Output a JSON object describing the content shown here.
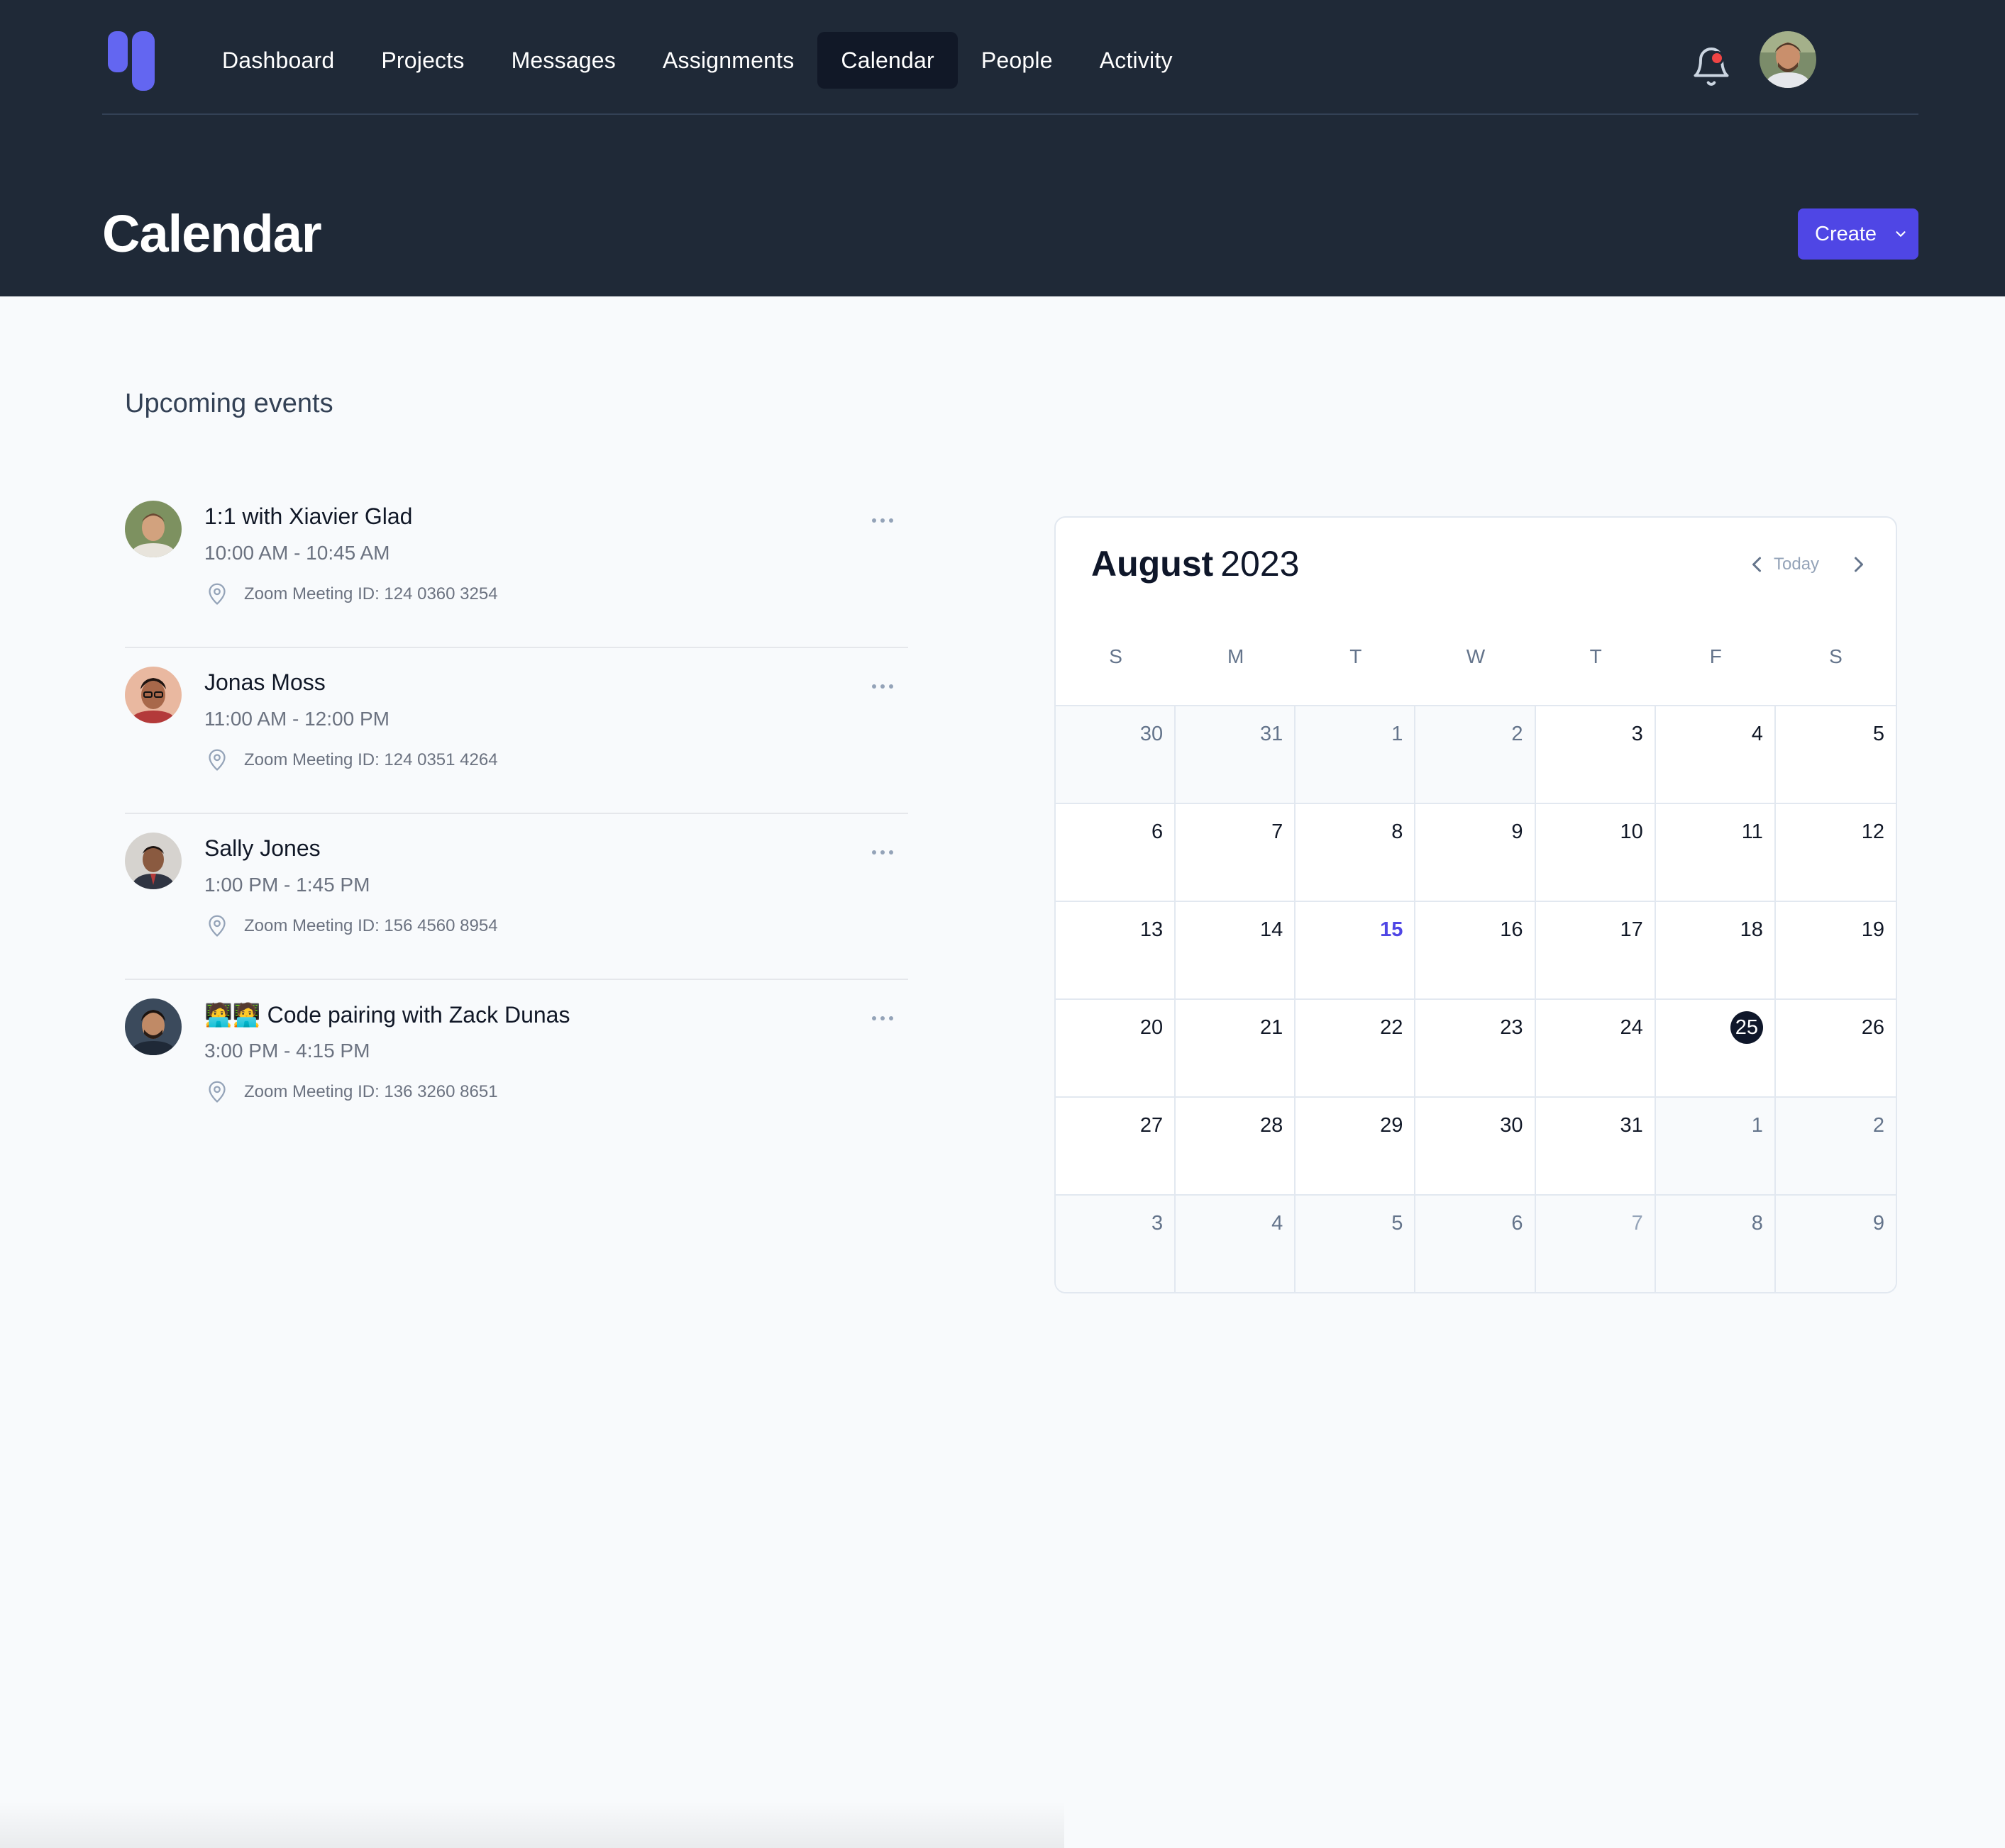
{
  "nav": {
    "items": [
      {
        "label": "Dashboard",
        "active": false
      },
      {
        "label": "Projects",
        "active": false
      },
      {
        "label": "Messages",
        "active": false
      },
      {
        "label": "Assignments",
        "active": false
      },
      {
        "label": "Calendar",
        "active": true
      },
      {
        "label": "People",
        "active": false
      },
      {
        "label": "Activity",
        "active": false
      }
    ],
    "notification_icon": "bell-icon",
    "has_notification": true
  },
  "page": {
    "title": "Calendar",
    "create_label": "Create"
  },
  "events": {
    "heading": "Upcoming events",
    "items": [
      {
        "title": "1:1 with Xiavier Glad",
        "time": "10:00 AM - 10:45 AM",
        "location": "Zoom Meeting ID: 124 0360 3254"
      },
      {
        "title": "Jonas Moss",
        "time": "11:00 AM - 12:00 PM",
        "location": "Zoom Meeting ID: 124 0351 4264"
      },
      {
        "title": "Sally Jones",
        "time": "1:00 PM - 1:45 PM",
        "location": "Zoom Meeting ID: 156 4560 8954"
      },
      {
        "title": "🧑‍💻🧑‍💻 Code pairing with Zack Dunas",
        "time": "3:00 PM - 4:15 PM",
        "location": "Zoom Meeting ID: 136 3260 8651"
      }
    ]
  },
  "calendar": {
    "month": "August",
    "year": "2023",
    "today_label": "Today",
    "weekdays": [
      "S",
      "M",
      "T",
      "W",
      "T",
      "F",
      "S"
    ],
    "days": [
      {
        "n": "30",
        "out": true
      },
      {
        "n": "31",
        "out": true
      },
      {
        "n": "1",
        "out": true
      },
      {
        "n": "2",
        "out": true
      },
      {
        "n": "3"
      },
      {
        "n": "4"
      },
      {
        "n": "5"
      },
      {
        "n": "6"
      },
      {
        "n": "7"
      },
      {
        "n": "8"
      },
      {
        "n": "9"
      },
      {
        "n": "10"
      },
      {
        "n": "11"
      },
      {
        "n": "12"
      },
      {
        "n": "13"
      },
      {
        "n": "14"
      },
      {
        "n": "15",
        "today": true
      },
      {
        "n": "16"
      },
      {
        "n": "17"
      },
      {
        "n": "18"
      },
      {
        "n": "19"
      },
      {
        "n": "20"
      },
      {
        "n": "21"
      },
      {
        "n": "22"
      },
      {
        "n": "23"
      },
      {
        "n": "24"
      },
      {
        "n": "25",
        "selected": true
      },
      {
        "n": "26"
      },
      {
        "n": "27"
      },
      {
        "n": "28"
      },
      {
        "n": "29"
      },
      {
        "n": "30"
      },
      {
        "n": "31"
      },
      {
        "n": "1",
        "out": true
      },
      {
        "n": "2",
        "out": true
      },
      {
        "n": "3",
        "out": true
      },
      {
        "n": "4",
        "out": true
      },
      {
        "n": "5",
        "out": true
      },
      {
        "n": "6",
        "out": true
      },
      {
        "n": "7",
        "out": true,
        "faint": true
      },
      {
        "n": "8",
        "out": true
      },
      {
        "n": "9",
        "out": true
      }
    ]
  },
  "colors": {
    "header_bg": "#1f2937",
    "accent": "#4f46e5",
    "selected_day": "#0f172a",
    "notification": "#ef4444"
  }
}
